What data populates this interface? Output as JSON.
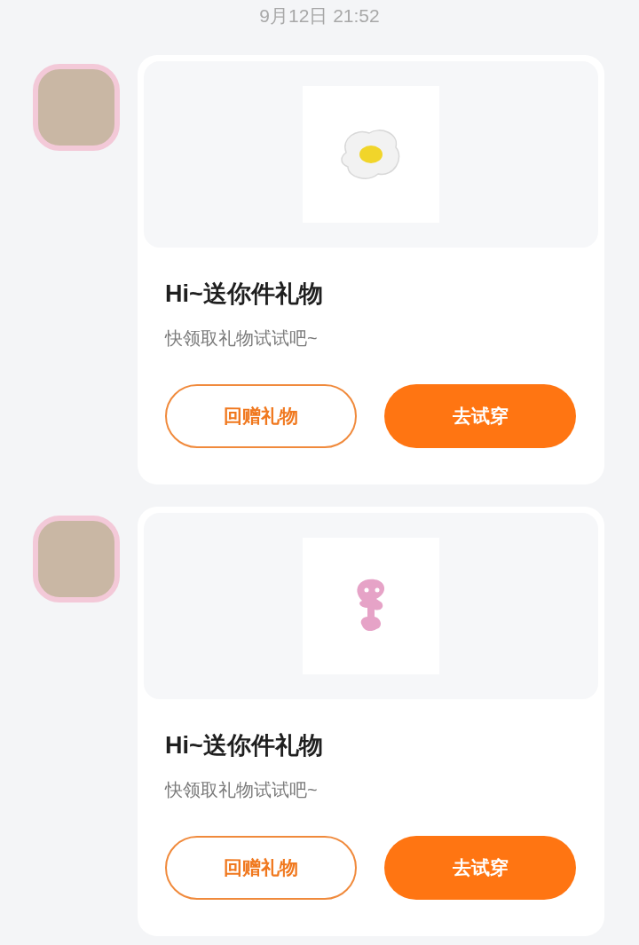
{
  "timestamp": "9月12日 21:52",
  "messages": [
    {
      "gift": {
        "kind": "egg"
      },
      "title": "Hi~送你件礼物",
      "subtitle": "快领取礼物试试吧~",
      "buttons": [
        {
          "label": "回赠礼物",
          "kind": "outline"
        },
        {
          "label": "去试穿",
          "kind": "filled"
        }
      ]
    },
    {
      "gift": {
        "kind": "figure"
      },
      "title": "Hi~送你件礼物",
      "subtitle": "快领取礼物试试吧~",
      "buttons": [
        {
          "label": "回赠礼物",
          "kind": "outline"
        },
        {
          "label": "去试穿",
          "kind": "filled"
        }
      ]
    }
  ]
}
